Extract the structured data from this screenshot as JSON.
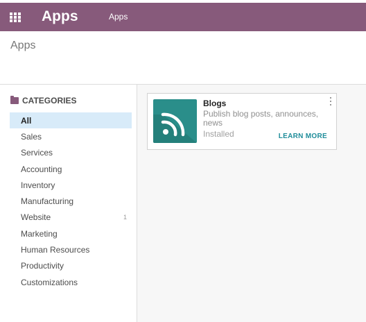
{
  "navbar": {
    "brand": "Apps",
    "menu_link": "Apps",
    "menu_icon": "apps-grid-icon",
    "color": "#875a7b"
  },
  "control_panel": {
    "breadcrumb": "Apps"
  },
  "sidebar": {
    "header": "CATEGORIES",
    "header_icon": "folder-icon",
    "items": [
      {
        "label": "All",
        "count": "",
        "active": true
      },
      {
        "label": "Sales",
        "count": ""
      },
      {
        "label": "Services",
        "count": ""
      },
      {
        "label": "Accounting",
        "count": ""
      },
      {
        "label": "Inventory",
        "count": ""
      },
      {
        "label": "Manufacturing",
        "count": ""
      },
      {
        "label": "Website",
        "count": "1"
      },
      {
        "label": "Marketing",
        "count": ""
      },
      {
        "label": "Human Resources",
        "count": ""
      },
      {
        "label": "Productivity",
        "count": ""
      },
      {
        "label": "Customizations",
        "count": ""
      }
    ]
  },
  "apps": [
    {
      "name": "Blogs",
      "summary": "Publish blog posts, announces, news",
      "status": "Installed",
      "action": "LEARN MORE",
      "icon": "rss-icon",
      "icon_color": "#2a8e8a"
    }
  ]
}
